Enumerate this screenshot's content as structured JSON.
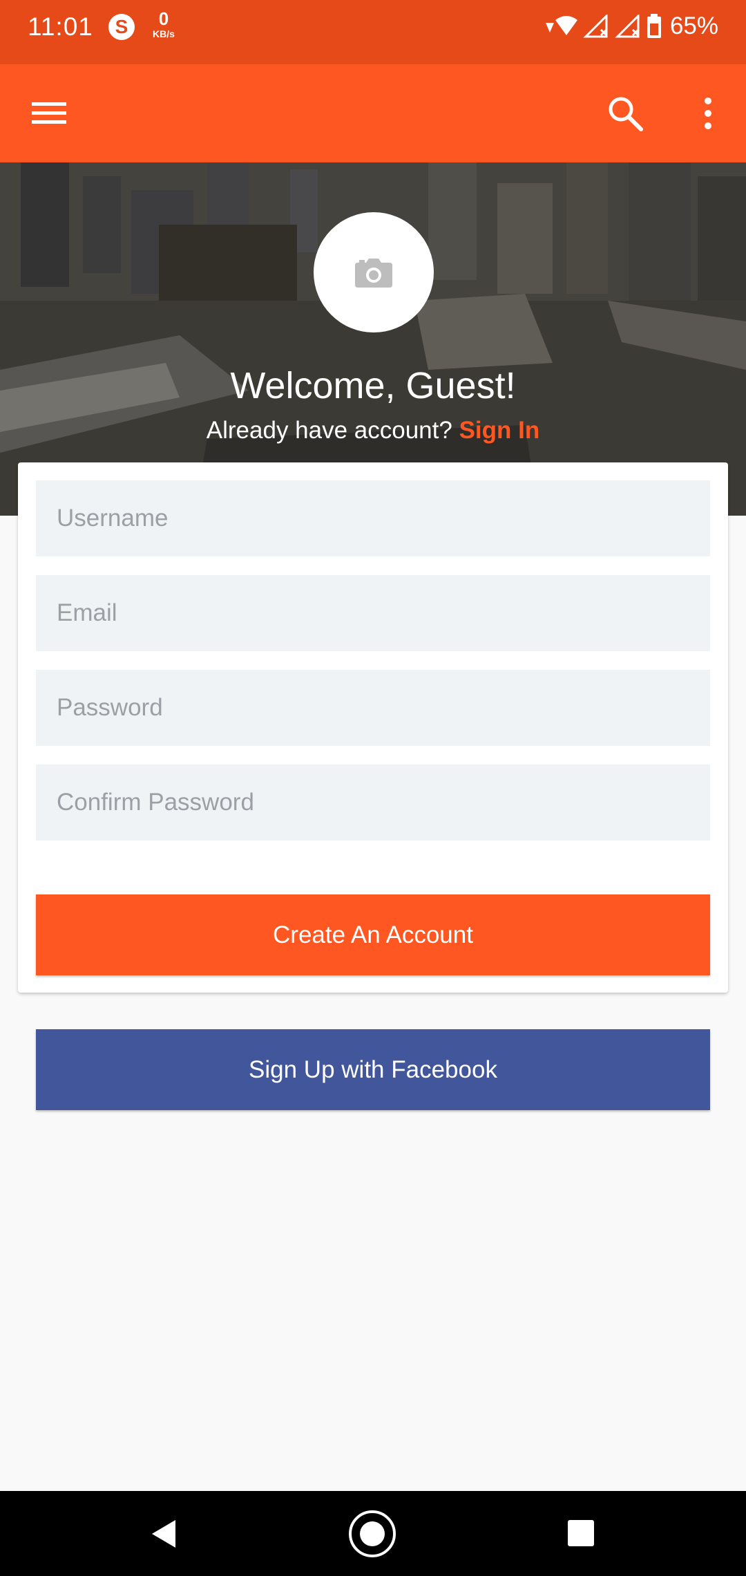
{
  "status_bar": {
    "time": "11:01",
    "net_speed_value": "0",
    "net_speed_unit": "KB/s",
    "battery_percent": "65%",
    "icons": [
      "skype-icon",
      "wifi-icon",
      "signal-icon",
      "signal-icon",
      "battery-icon"
    ]
  },
  "app_bar": {
    "icons": [
      "menu-icon",
      "search-icon",
      "more-vert-icon"
    ],
    "color": "#ff5722"
  },
  "header": {
    "avatar_icon": "camera-icon",
    "welcome": "Welcome, Guest!",
    "already_text": "Already have account?",
    "sign_in_label": "Sign In"
  },
  "form": {
    "username_placeholder": "Username",
    "email_placeholder": "Email",
    "password_placeholder": "Password",
    "confirm_password_placeholder": "Confirm Password",
    "create_button": "Create An Account"
  },
  "facebook_button": "Sign Up with Facebook",
  "nav_bar": {
    "icons": [
      "back-icon",
      "home-icon",
      "recents-icon"
    ]
  },
  "colors": {
    "accent": "#ff5722",
    "status_bar": "#e64a19",
    "facebook": "#42569c"
  }
}
